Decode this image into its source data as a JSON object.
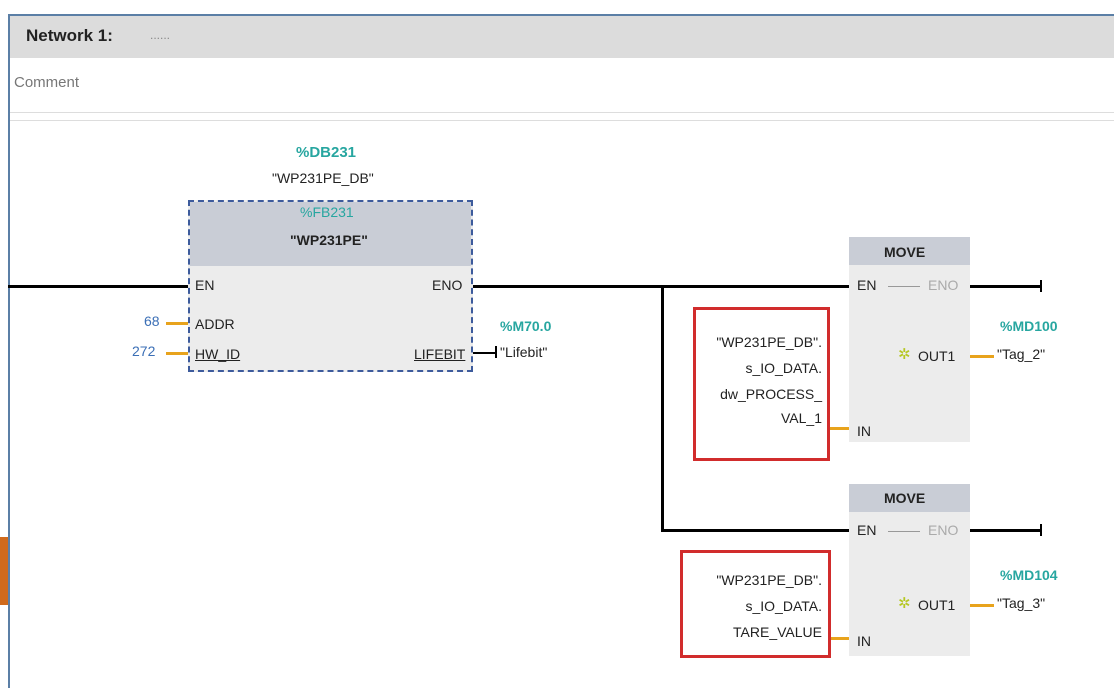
{
  "network": {
    "title": "Network 1:",
    "dots": "......",
    "comment": "Comment"
  },
  "fb": {
    "db_addr": "%DB231",
    "db_name": "\"WP231PE_DB\"",
    "fb_addr": "%FB231",
    "fb_name": "\"WP231PE\"",
    "pin_en": "EN",
    "pin_eno": "ENO",
    "pin_addr": "ADDR",
    "pin_hwid": "HW_ID",
    "pin_lifebit": "LIFEBIT",
    "val_addr": "68",
    "val_hwid": "272",
    "lifebit_addr": "%M70.0",
    "lifebit_tag": "\"Lifebit\""
  },
  "move1": {
    "title": "MOVE",
    "en": "EN",
    "eno": "ENO",
    "out": "OUT1",
    "in": "IN",
    "in_lines": [
      "\"WP231PE_DB\".",
      "s_IO_DATA.",
      "dw_PROCESS_",
      "VAL_1"
    ],
    "out_addr": "%MD100",
    "out_tag": "\"Tag_2\""
  },
  "move2": {
    "title": "MOVE",
    "en": "EN",
    "eno": "ENO",
    "out": "OUT1",
    "in": "IN",
    "in_lines": [
      "\"WP231PE_DB\".",
      "s_IO_DATA.",
      "TARE_VALUE"
    ],
    "out_addr": "%MD104",
    "out_tag": "\"Tag_3\""
  },
  "colors": {
    "teal": "#27a6a0",
    "orange_pin": "#e8a31c",
    "highlight_red": "#d12c2c",
    "accent_blue": "#3b6fb6"
  }
}
